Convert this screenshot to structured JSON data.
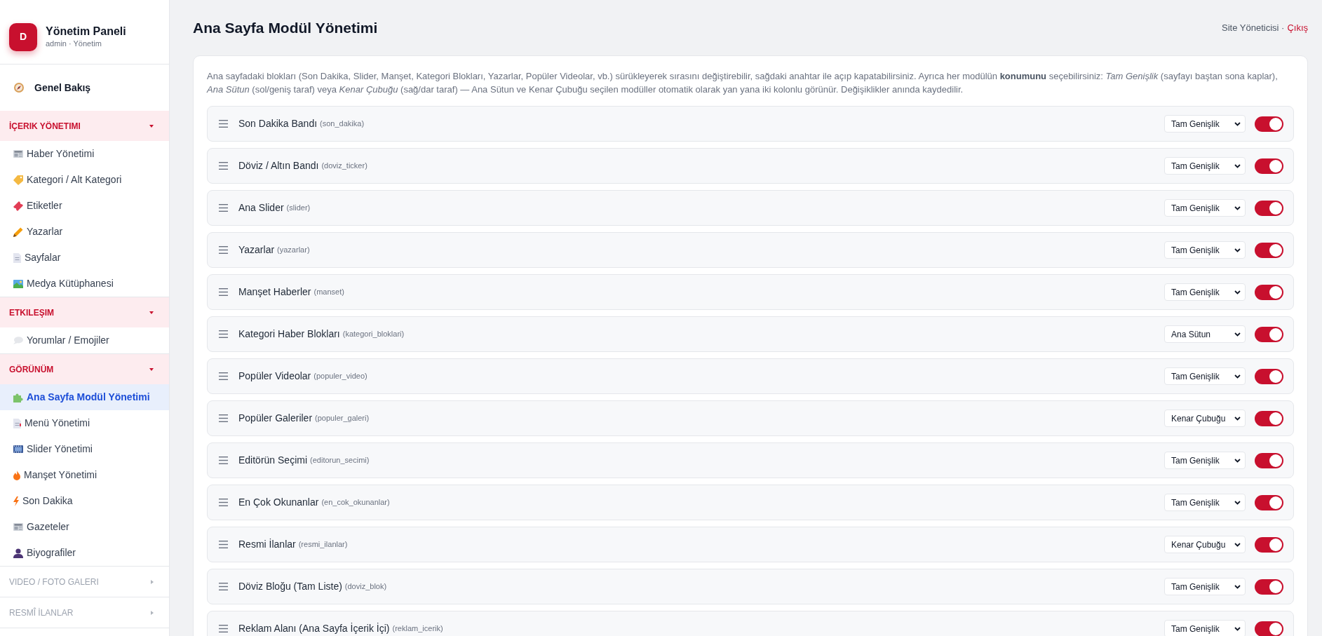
{
  "sidebar": {
    "logo_letter": "D",
    "title": "Yönetim Paneli",
    "subtitle": "admin · Yönetim",
    "overview": {
      "label": "Genel Bakış",
      "selected": false
    },
    "sections": [
      {
        "label": "İÇERIK YÖNETIMI",
        "expanded": true,
        "items": [
          {
            "label": "Haber Yönetimi",
            "selected": false
          },
          {
            "label": "Kategori / Alt Kategori",
            "selected": false
          },
          {
            "label": "Etiketler",
            "selected": false
          },
          {
            "label": "Yazarlar",
            "selected": false
          },
          {
            "label": "Sayfalar",
            "selected": false
          },
          {
            "label": "Medya Kütüphanesi",
            "selected": false
          }
        ]
      },
      {
        "label": "ETKILEŞIM",
        "expanded": true,
        "items": [
          {
            "label": "Yorumlar / Emojiler",
            "selected": false
          }
        ]
      },
      {
        "label": "GÖRÜNÜM",
        "expanded": true,
        "items": [
          {
            "label": "Ana Sayfa Modül Yönetimi",
            "selected": true
          },
          {
            "label": "Menü Yönetimi",
            "selected": false
          },
          {
            "label": "Slider Yönetimi",
            "selected": false
          },
          {
            "label": "Manşet Yönetimi",
            "selected": false
          },
          {
            "label": "Son Dakika",
            "selected": false
          },
          {
            "label": "Gazeteler",
            "selected": false
          },
          {
            "label": "Biyografiler",
            "selected": false
          }
        ]
      },
      {
        "label": "VIDEO / FOTO GALERI",
        "expanded": false
      },
      {
        "label": "RESMÎ İLANLAR",
        "expanded": false
      }
    ]
  },
  "header": {
    "title": "Ana Sayfa Modül Yönetimi",
    "user": "Site Yöneticisi ·",
    "logout": "Çıkış"
  },
  "description": "Ana sayfadaki blokları (Son Dakika, Slider, Manşet, Kategori Blokları, Yazarlar, Popüler Videolar, vb.) sürükleyerek sırasını değiştirebilir, sağdaki anahtar ile açıp kapatabilirsiniz. Ayrıca her modülün **konumunu** seçebilirsiniz: *Tam Genişlik* (sayfayı baştan sona kaplar), *Ana Sütun* (sol/geniş taraf) veya *Kenar Çubuğu* (sağ/dar taraf) — Ana Sütun ve Kenar Çubuğu seçilen modüller otomatik olarak yan yana iki kolonlu görünür. Değişiklikler anında kaydedilir.",
  "modules": [
    {
      "name": "Son Dakika Bandı",
      "key": "(son_dakika)",
      "position": "Tam Genişlik",
      "on": true
    },
    {
      "name": "Döviz / Altın Bandı",
      "key": "(doviz_ticker)",
      "position": "Tam Genişlik",
      "on": true
    },
    {
      "name": "Ana Slider",
      "key": "(slider)",
      "position": "Tam Genişlik",
      "on": true
    },
    {
      "name": "Yazarlar",
      "key": "(yazarlar)",
      "position": "Tam Genişlik",
      "on": true
    },
    {
      "name": "Manşet Haberler",
      "key": "(manset)",
      "position": "Tam Genişlik",
      "on": true
    },
    {
      "name": "Kategori Haber Blokları",
      "key": "(kategori_bloklari)",
      "position": "Ana Sütun",
      "on": true
    },
    {
      "name": "Popüler Videolar",
      "key": "(populer_video)",
      "position": "Tam Genişlik",
      "on": true
    },
    {
      "name": "Popüler Galeriler",
      "key": "(populer_galeri)",
      "position": "Kenar Çubuğu",
      "on": true
    },
    {
      "name": "Editörün Seçimi",
      "key": "(editorun_secimi)",
      "position": "Tam Genişlik",
      "on": true
    },
    {
      "name": "En Çok Okunanlar",
      "key": "(en_cok_okunanlar)",
      "position": "Tam Genişlik",
      "on": true
    },
    {
      "name": "Resmi İlanlar",
      "key": "(resmi_ilanlar)",
      "position": "Kenar Çubuğu",
      "on": true
    },
    {
      "name": "Döviz Bloğu (Tam Liste)",
      "key": "(doviz_blok)",
      "position": "Tam Genişlik",
      "on": true
    },
    {
      "name": "Reklam Alanı (Ana Sayfa İçerik İçi)",
      "key": "(reklam_icerik)",
      "position": "Tam Genişlik",
      "on": true
    }
  ]
}
